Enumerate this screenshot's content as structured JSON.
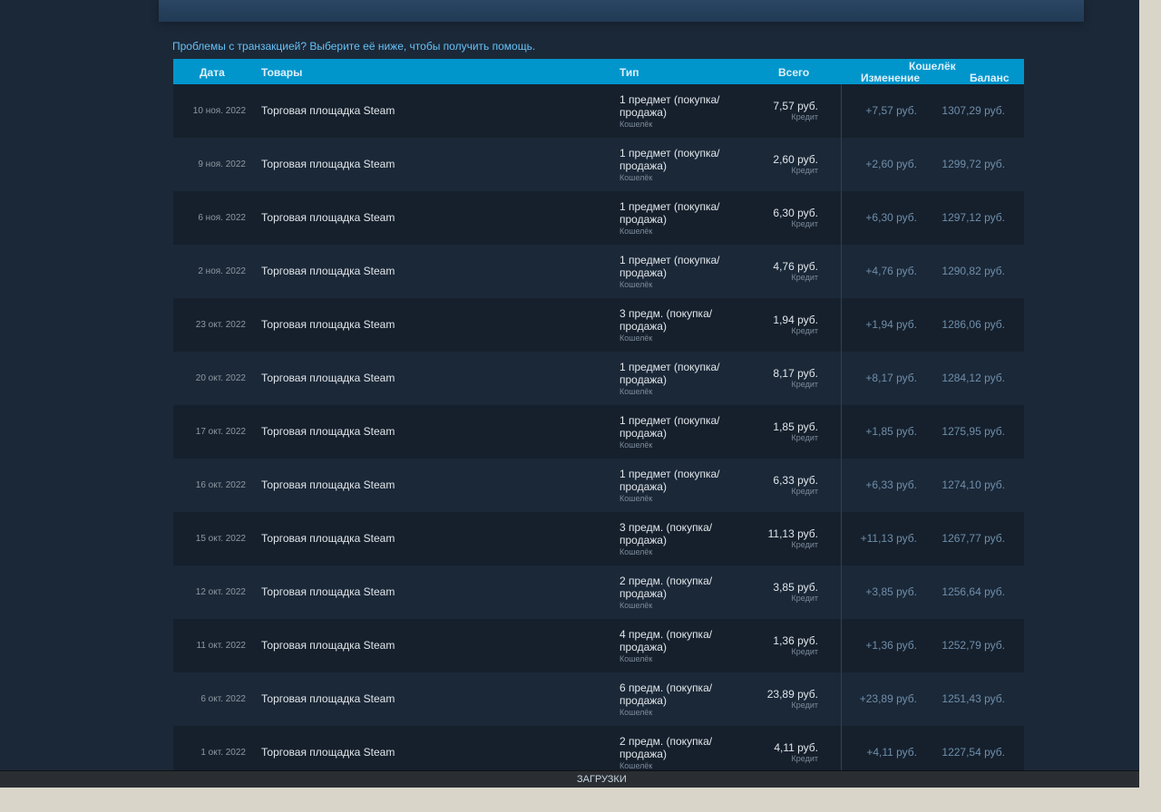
{
  "help_link": "Проблемы с транзакцией? Выберите её ниже, чтобы получить помощь.",
  "headers": {
    "date": "Дата",
    "items": "Товары",
    "type": "Тип",
    "total": "Всего",
    "wallet": "Кошелёк",
    "change": "Изменение",
    "balance": "Баланс"
  },
  "rows": [
    {
      "date": "10 ноя. 2022",
      "item": "Торговая площадка Steam",
      "type": "1 предмет (покупка/ продажа)",
      "method": "Кошелёк",
      "total": "7,57 руб.",
      "total_label": "Кредит",
      "change": "+7,57 руб.",
      "balance": "1307,29 руб."
    },
    {
      "date": "9 ноя. 2022",
      "item": "Торговая площадка Steam",
      "type": "1 предмет (покупка/ продажа)",
      "method": "Кошелёк",
      "total": "2,60 руб.",
      "total_label": "Кредит",
      "change": "+2,60 руб.",
      "balance": "1299,72 руб."
    },
    {
      "date": "6 ноя. 2022",
      "item": "Торговая площадка Steam",
      "type": "1 предмет (покупка/ продажа)",
      "method": "Кошелёк",
      "total": "6,30 руб.",
      "total_label": "Кредит",
      "change": "+6,30 руб.",
      "balance": "1297,12 руб."
    },
    {
      "date": "2 ноя. 2022",
      "item": "Торговая площадка Steam",
      "type": "1 предмет (покупка/ продажа)",
      "method": "Кошелёк",
      "total": "4,76 руб.",
      "total_label": "Кредит",
      "change": "+4,76 руб.",
      "balance": "1290,82 руб."
    },
    {
      "date": "23 окт. 2022",
      "item": "Торговая площадка Steam",
      "type": "3 предм. (покупка/ продажа)",
      "method": "Кошелёк",
      "total": "1,94 руб.",
      "total_label": "Кредит",
      "change": "+1,94 руб.",
      "balance": "1286,06 руб."
    },
    {
      "date": "20 окт. 2022",
      "item": "Торговая площадка Steam",
      "type": "1 предмет (покупка/ продажа)",
      "method": "Кошелёк",
      "total": "8,17 руб.",
      "total_label": "Кредит",
      "change": "+8,17 руб.",
      "balance": "1284,12 руб."
    },
    {
      "date": "17 окт. 2022",
      "item": "Торговая площадка Steam",
      "type": "1 предмет (покупка/ продажа)",
      "method": "Кошелёк",
      "total": "1,85 руб.",
      "total_label": "Кредит",
      "change": "+1,85 руб.",
      "balance": "1275,95 руб."
    },
    {
      "date": "16 окт. 2022",
      "item": "Торговая площадка Steam",
      "type": "1 предмет (покупка/ продажа)",
      "method": "Кошелёк",
      "total": "6,33 руб.",
      "total_label": "Кредит",
      "change": "+6,33 руб.",
      "balance": "1274,10 руб."
    },
    {
      "date": "15 окт. 2022",
      "item": "Торговая площадка Steam",
      "type": "3 предм. (покупка/ продажа)",
      "method": "Кошелёк",
      "total": "11,13 руб.",
      "total_label": "Кредит",
      "change": "+11,13 руб.",
      "balance": "1267,77 руб."
    },
    {
      "date": "12 окт. 2022",
      "item": "Торговая площадка Steam",
      "type": "2 предм. (покупка/ продажа)",
      "method": "Кошелёк",
      "total": "3,85 руб.",
      "total_label": "Кредит",
      "change": "+3,85 руб.",
      "balance": "1256,64 руб."
    },
    {
      "date": "11 окт. 2022",
      "item": "Торговая площадка Steam",
      "type": "4 предм. (покупка/ продажа)",
      "method": "Кошелёк",
      "total": "1,36 руб.",
      "total_label": "Кредит",
      "change": "+1,36 руб.",
      "balance": "1252,79 руб."
    },
    {
      "date": "6 окт. 2022",
      "item": "Торговая площадка Steam",
      "type": "6 предм. (покупка/ продажа)",
      "method": "Кошелёк",
      "total": "23,89 руб.",
      "total_label": "Кредит",
      "change": "+23,89 руб.",
      "balance": "1251,43 руб."
    },
    {
      "date": "1 окт. 2022",
      "item": "Торговая площадка Steam",
      "type": "2 предм. (покупка/ продажа)",
      "method": "Кошелёк",
      "total": "4,11 руб.",
      "total_label": "Кредит",
      "change": "+4,11 руб.",
      "balance": "1227,54 руб."
    }
  ],
  "footer": {
    "label": "ЗАГРУЗКИ"
  }
}
